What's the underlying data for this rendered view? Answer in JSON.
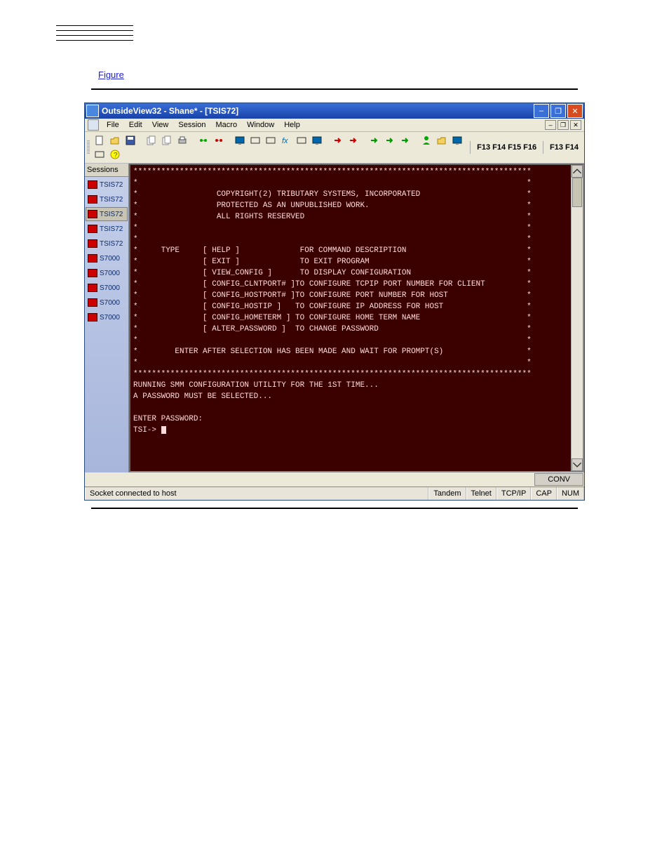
{
  "toplinks": [
    "",
    "",
    "",
    ""
  ],
  "intro_text": "",
  "figure_link": "Figure",
  "window": {
    "title": "OutsideView32 - Shane* - [TSIS72]",
    "menus": [
      "File",
      "Edit",
      "View",
      "Session",
      "Macro",
      "Window",
      "Help"
    ],
    "tool_fkeys_a": "F13 F14 F15 F16",
    "tool_fkeys_b": "F13 F14",
    "sessions_header": "Sessions",
    "sessions": [
      {
        "label": "TSIS72",
        "active": false
      },
      {
        "label": "TSIS72",
        "active": false
      },
      {
        "label": "TSIS72",
        "active": true
      },
      {
        "label": "TSIS72",
        "active": false
      },
      {
        "label": "TSIS72",
        "active": false
      },
      {
        "label": "S7000",
        "active": false
      },
      {
        "label": "S7000",
        "active": false
      },
      {
        "label": "S7000",
        "active": false
      },
      {
        "label": "S7000",
        "active": false
      },
      {
        "label": "S7000",
        "active": false
      }
    ],
    "terminal_lines": [
      "**************************************************************************************",
      "*                                                                                    *",
      "*                 COPYRIGHT(2) TRIBUTARY SYSTEMS, INCORPORATED                       *",
      "*                 PROTECTED AS AN UNPUBLISHED WORK.                                  *",
      "*                 ALL RIGHTS RESERVED                                                *",
      "*                                                                                    *",
      "*                                                                                    *",
      "*     TYPE     [ HELP ]             FOR COMMAND DESCRIPTION                          *",
      "*              [ EXIT ]             TO EXIT PROGRAM                                  *",
      "*              [ VIEW_CONFIG ]      TO DISPLAY CONFIGURATION                         *",
      "*              [ CONFIG_CLNTPORT# ]TO CONFIGURE TCPIP PORT NUMBER FOR CLIENT         *",
      "*              [ CONFIG_HOSTPORT# ]TO CONFIGURE PORT NUMBER FOR HOST                 *",
      "*              [ CONFIG_HOSTIP ]   TO CONFIGURE IP ADDRESS FOR HOST                  *",
      "*              [ CONFIG_HOMETERM ] TO CONFIGURE HOME TERM NAME                       *",
      "*              [ ALTER_PASSWORD ]  TO CHANGE PASSWORD                                *",
      "*                                                                                    *",
      "*        ENTER AFTER SELECTION HAS BEEN MADE AND WAIT FOR PROMPT(S)                  *",
      "*                                                                                    *",
      "**************************************************************************************",
      "RUNNING SMM CONFIGURATION UTILITY FOR THE 1ST TIME...",
      "A PASSWORD MUST BE SELECTED...",
      "",
      "ENTER PASSWORD:"
    ],
    "terminal_prompt": "TSI->",
    "conv_label": "CONV",
    "status": {
      "main": "Socket connected to host",
      "cells": [
        "Tandem",
        "Telnet",
        "TCP/IP",
        "CAP",
        "NUM"
      ]
    }
  },
  "toolbar_icons": [
    "new-icon",
    "open-icon",
    "save-icon",
    "copy-icon",
    "paste-icon",
    "print-icon",
    "connect-icon",
    "disconnect-icon",
    "monitor-icon",
    "glasses-icon",
    "keyboard-red-icon",
    "fx-icon",
    "chart-icon",
    "screen-icon",
    "arrow-red1-icon",
    "arrow-red2-icon",
    "arrow-grn1-icon",
    "arrow-grn2-icon",
    "arrow-grn3-icon",
    "person-icon",
    "folder-icon",
    "screen2-icon",
    "rect-icon",
    "help-icon"
  ]
}
